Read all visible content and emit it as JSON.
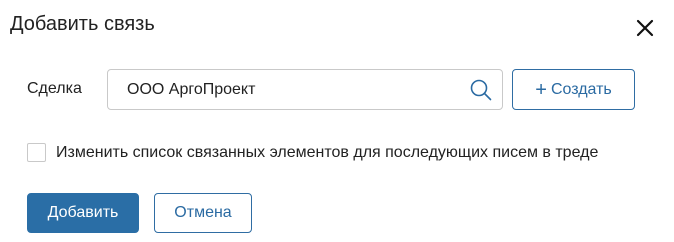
{
  "dialog": {
    "title": "Добавить связь",
    "close_icon": "close-icon"
  },
  "deal_field": {
    "label": "Сделка",
    "value": "ООО АргоПроект",
    "search_icon": "search-icon"
  },
  "create_button": {
    "icon": "plus-icon",
    "plus": "+",
    "label": "Создать"
  },
  "option": {
    "checked": false,
    "label": "Изменить список связанных элементов для последующих писем в треде"
  },
  "actions": {
    "submit_label": "Добавить",
    "cancel_label": "Отмена"
  },
  "colors": {
    "accent": "#2a6ea6",
    "border": "#c9c9c9",
    "text": "#222222"
  }
}
